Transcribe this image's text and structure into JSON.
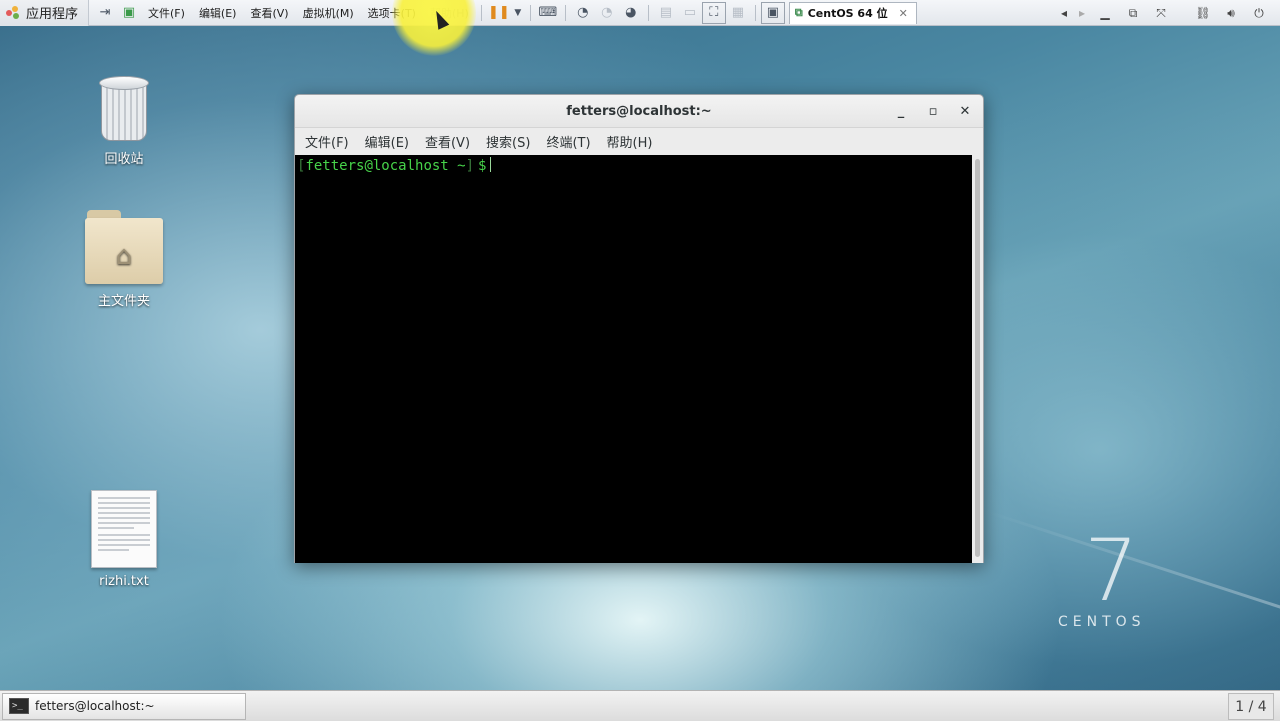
{
  "topbar": {
    "apps_label": "应用程序",
    "menu": [
      "文件(F)",
      "编辑(E)",
      "查看(V)",
      "虚拟机(M)",
      "选项卡(T)",
      "帮助(H)"
    ],
    "vm_tab_label": "CentOS 64 位",
    "vm_tab_close": "✕"
  },
  "desktop": {
    "icons": [
      {
        "label": "回收站"
      },
      {
        "label": "主文件夹"
      },
      {
        "label": "rizhi.txt"
      }
    ],
    "os_version": "7",
    "os_name": "CENTOS"
  },
  "terminal": {
    "title": "fetters@localhost:~",
    "menu": [
      "文件(F)",
      "编辑(E)",
      "查看(V)",
      "搜索(S)",
      "终端(T)",
      "帮助(H)"
    ],
    "prompt_open": "[",
    "prompt_text": "fetters@localhost ~",
    "prompt_close": "]",
    "prompt_symbol": "$"
  },
  "taskbar": {
    "task_label": "fetters@localhost:~",
    "workspace": "1 / 4"
  }
}
